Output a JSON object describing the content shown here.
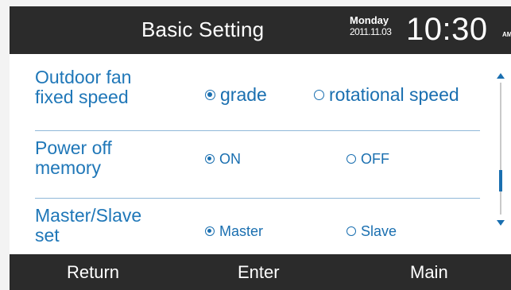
{
  "header": {
    "title": "Basic Setting",
    "day": "Monday",
    "date": "2011.11.03",
    "time": "10:30",
    "ampm": "AM"
  },
  "settings": [
    {
      "label_line1": "Outdoor fan",
      "label_line2": "fixed speed",
      "options": [
        {
          "label": "grade",
          "selected": true
        },
        {
          "label": "rotational speed",
          "selected": false
        }
      ]
    },
    {
      "label_line1": "Power off",
      "label_line2": "memory",
      "options": [
        {
          "label": "ON",
          "selected": true
        },
        {
          "label": "OFF",
          "selected": false
        }
      ]
    },
    {
      "label_line1": "Master/Slave",
      "label_line2": "set",
      "options": [
        {
          "label": "Master",
          "selected": true
        },
        {
          "label": "Slave",
          "selected": false
        }
      ]
    }
  ],
  "footer": {
    "return_label": "Return",
    "enter_label": "Enter",
    "main_label": "Main"
  },
  "colors": {
    "bar_background": "#2b2b2b",
    "accent": "#1a6fb0",
    "divider": "#8fb8d8"
  },
  "icons": {
    "scroll_up": "triangle-up-icon",
    "scroll_down": "triangle-down-icon",
    "radio_checked": "radio-checked-icon",
    "radio_unchecked": "radio-unchecked-icon"
  }
}
